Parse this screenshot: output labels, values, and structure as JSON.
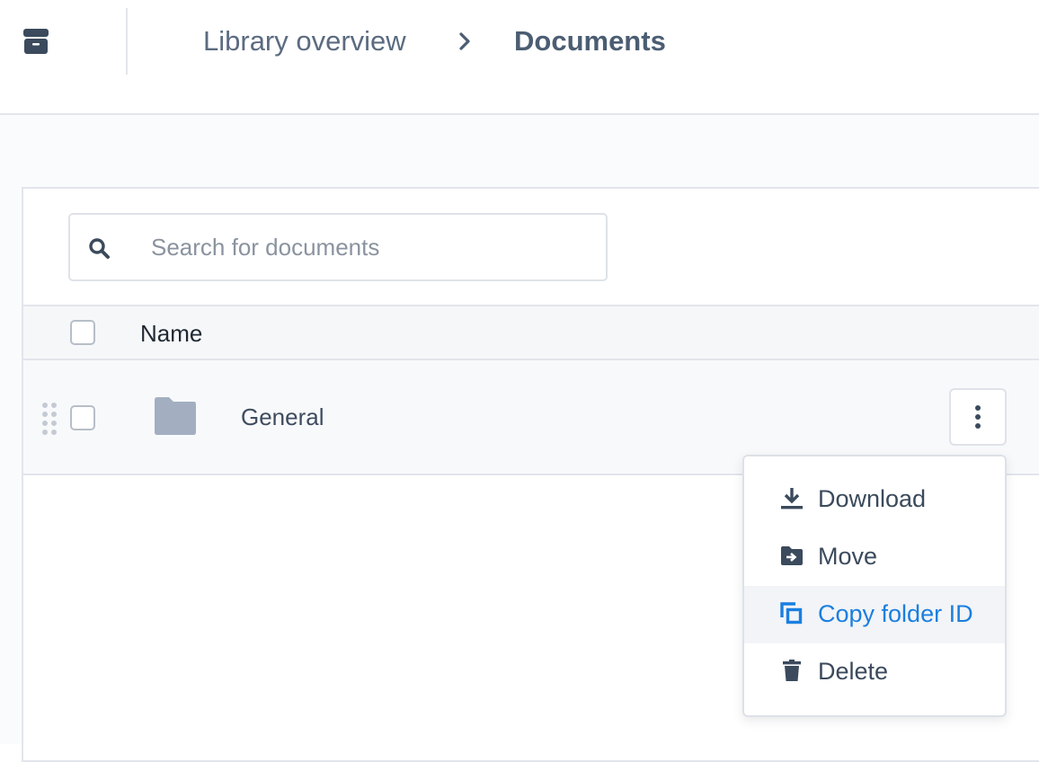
{
  "breadcrumb": {
    "items": [
      "Library overview",
      "Documents"
    ]
  },
  "search": {
    "placeholder": "Search for documents",
    "value": ""
  },
  "table": {
    "columns": [
      "Name"
    ],
    "rows": [
      {
        "name": "General",
        "type": "folder"
      }
    ]
  },
  "context_menu": {
    "items": [
      {
        "label": "Download",
        "icon": "download-icon"
      },
      {
        "label": "Move",
        "icon": "move-to-folder-icon"
      },
      {
        "label": "Copy folder ID",
        "icon": "copy-icon",
        "highlighted": true
      },
      {
        "label": "Delete",
        "icon": "trash-icon"
      }
    ]
  },
  "colors": {
    "accent": "#1a7fe0",
    "icon_dark": "#3b4a5c",
    "folder": "#a3afc1",
    "border": "#e2e5ec"
  }
}
